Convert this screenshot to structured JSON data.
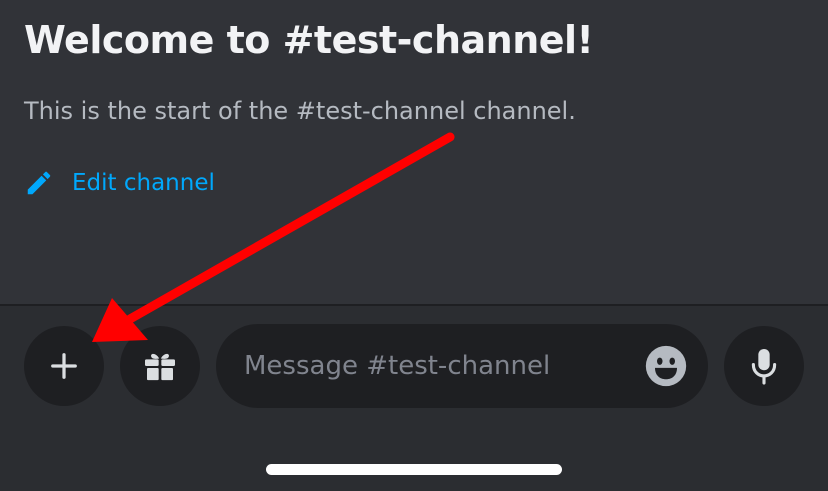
{
  "channel": {
    "welcome_title": "Welcome to #test-channel!",
    "welcome_subtitle": "This is the start of the #test-channel channel.",
    "edit_label": "Edit channel"
  },
  "composer": {
    "placeholder": "Message #test-channel",
    "value": ""
  },
  "icons": {
    "edit": "pencil-icon",
    "add": "plus-icon",
    "gift": "gift-icon",
    "emoji": "emoji-smile-icon",
    "mic": "microphone-icon"
  },
  "colors": {
    "background": "#313338",
    "composer_background": "#2b2d31",
    "button_background": "#1e1f22",
    "accent_link": "#00a8fc",
    "annotation_arrow": "#ff0000"
  }
}
